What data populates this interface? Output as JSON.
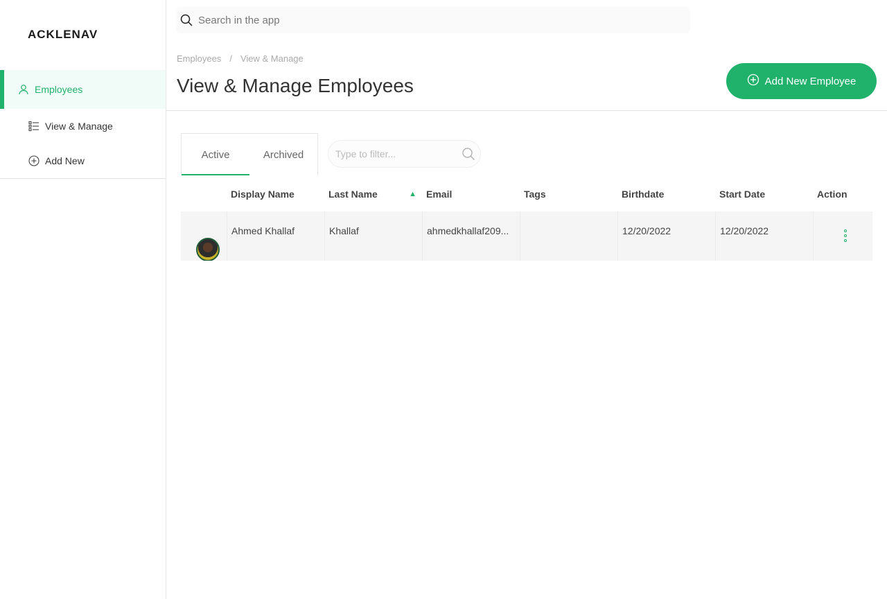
{
  "brand": {
    "logo_text": "ACKLENAVE"
  },
  "colors": {
    "accent": "#20b26b",
    "accent_bg": "#f1fbf7"
  },
  "sidebar": {
    "items": [
      {
        "label": "Employees",
        "icon": "user-icon",
        "active": true
      },
      {
        "label": "View & Manage",
        "icon": "list-icon",
        "active": false
      },
      {
        "label": "Add New",
        "icon": "plus-circle-icon",
        "active": false
      }
    ]
  },
  "topbar": {
    "search_placeholder": "Search in the app"
  },
  "header": {
    "breadcrumb": [
      "Employees",
      "/",
      "View & Manage"
    ],
    "title": "View & Manage Employees",
    "add_button_label": "Add New Employee"
  },
  "tabs": [
    {
      "label": "Active",
      "active": true
    },
    {
      "label": "Archived",
      "active": false
    }
  ],
  "filter": {
    "placeholder": "Type to filter..."
  },
  "table": {
    "columns": [
      "Display Name",
      "Last Name",
      "Email",
      "Tags",
      "Birthdate",
      "Start Date",
      "Action"
    ],
    "sorted_column": "Last Name",
    "sort_direction": "ascending",
    "rows": [
      {
        "display_name": "Ahmed Khallaf",
        "last_name": "Khallaf",
        "email": "ahmedkhallaf209...",
        "tags": "",
        "birthdate": "12/20/2022",
        "start_date": "12/20/2022"
      }
    ]
  }
}
